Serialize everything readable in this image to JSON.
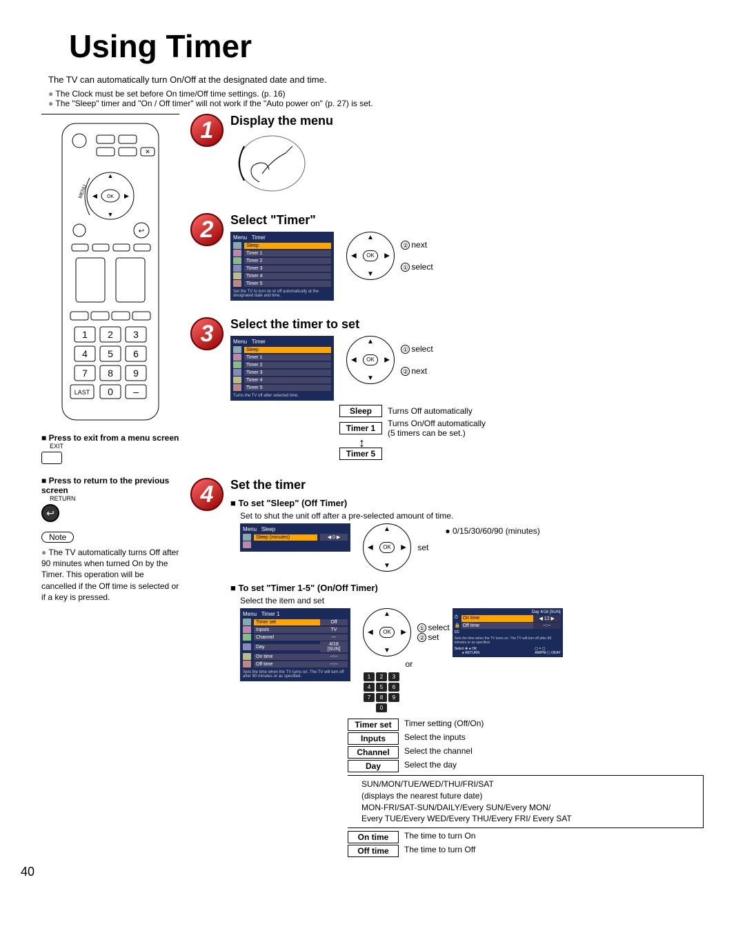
{
  "page": {
    "title": "Using Timer",
    "number": "40",
    "intro": "The TV can automatically turn On/Off at the designated date and time.",
    "bullets": [
      "The Clock must be set before On time/Off time settings. (p. 16)",
      "The \"Sleep\" timer and \"On / Off timer\" will not work if the \"Auto power on\" (p. 27) is set."
    ]
  },
  "remote": {
    "numpad": [
      "1",
      "2",
      "3",
      "4",
      "5",
      "6",
      "7",
      "8",
      "9",
      "0"
    ],
    "last": "LAST",
    "dash": "–"
  },
  "steps": {
    "s1": {
      "num": "1",
      "title": "Display the menu"
    },
    "s2": {
      "num": "2",
      "title": "Select \"Timer\"",
      "menu": {
        "hd_menu": "Menu",
        "hd_timer": "Timer",
        "items": [
          "Sleep",
          "Timer 1",
          "Timer 2",
          "Timer 3",
          "Timer 4",
          "Timer 5"
        ],
        "desc": "Set the TV to turn on or off automatically at the designated date and time."
      },
      "nav": {
        "l1": "next",
        "l2": "select",
        "c1": "②",
        "c2": "①"
      }
    },
    "s3": {
      "num": "3",
      "title": "Select the timer to set",
      "menu": {
        "hd_menu": "Menu",
        "hd_timer": "Timer",
        "items": [
          "Sleep",
          "Timer 1",
          "Timer 2",
          "Timer 3",
          "Timer 4",
          "Timer 5"
        ],
        "desc": "Turns the TV off after selected time."
      },
      "nav": {
        "l1": "select",
        "l2": "next",
        "c1": "①",
        "c2": "②"
      },
      "labels": {
        "sleep": "Sleep",
        "sleep_d": "Turns Off automatically",
        "t1": "Timer 1",
        "t1_d": "Turns On/Off automatically",
        "t1_d2": "(5 timers can be set.)",
        "t5": "Timer 5",
        "arrow": "⥍"
      }
    },
    "s4": {
      "num": "4",
      "title": "Set the timer",
      "sleep": {
        "sub": "To set \"Sleep\" (Off Timer)",
        "txt": "Set to shut the unit off after a pre-selected amount of time.",
        "menu": {
          "hd_menu": "Menu",
          "hd": "Sleep",
          "row": "Sleep (minutes)",
          "val": "0"
        },
        "nav_lab": "set",
        "vals": "0/15/30/60/90 (minutes)"
      },
      "onoff": {
        "sub": "To set \"Timer 1-5\" (On/Off Timer)",
        "txt": "Select the item and set",
        "menu": {
          "hd_menu": "Menu",
          "hd": "Timer 1",
          "rows": [
            {
              "l": "Timer set",
              "v": "Off"
            },
            {
              "l": "Inputs",
              "v": "TV"
            },
            {
              "l": "Channel",
              "v": "---"
            },
            {
              "l": "Day",
              "v": "4/18 [SUN]"
            },
            {
              "l": "On time",
              "v": "--:--"
            },
            {
              "l": "Off time",
              "v": "--:--"
            }
          ],
          "desc": "Sets the time when the TV turns on. The TV will turn off after 90 minutes or as specified."
        },
        "nav": {
          "l1": "select",
          "l2": "set",
          "c1": "①",
          "c2": "②"
        },
        "or": "or",
        "osd": {
          "date": "4/18 [SUN]",
          "row1_l": "On time",
          "row1_v": "12",
          "row2_l": "Off time",
          "row2_v": "--:--",
          "desc": "Sets the time when the TV turns on. The TV will turn off after 90 minutes or as specified.",
          "foot": "Select",
          "ok": "OK",
          "ret": "RETURN",
          "ampm": "AM/PM",
          "okv": "OKAY"
        },
        "items": {
          "timer_set": {
            "l": "Timer set",
            "d": "Timer setting (Off/On)"
          },
          "inputs": {
            "l": "Inputs",
            "d": "Select the inputs"
          },
          "channel": {
            "l": "Channel",
            "d": "Select the channel"
          },
          "day": {
            "l": "Day",
            "d": "Select the day"
          },
          "day_opts": "SUN/MON/TUE/WED/THU/FRI/SAT\n(displays the nearest future date)\nMON-FRI/SAT-SUN/DAILY/Every SUN/Every MON/\nEvery TUE/Every WED/Every THU/Every FRI/ Every SAT",
          "on_time": {
            "l": "On time",
            "d": "The time to turn On"
          },
          "off_time": {
            "l": "Off time",
            "d": "The time to turn Off"
          }
        }
      }
    }
  },
  "side": {
    "exit": {
      "hd": "Press to exit from a menu screen",
      "lab": "EXIT"
    },
    "return": {
      "hd": "Press to return to the previous screen",
      "lab": "RETURN"
    },
    "note_pill": "Note",
    "note": "The TV automatically turns Off after 90 minutes when turned On by the Timer. This operation will be cancelled if the Off time is selected or if a key is pressed."
  }
}
